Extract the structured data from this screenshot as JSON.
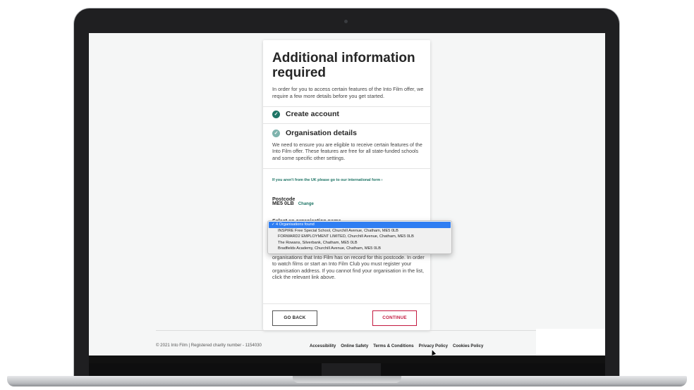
{
  "card": {
    "title": "Additional information required",
    "intro": "In order for you to access certain features of the Into Film offer, we require a few more details before you get started.",
    "steps": [
      {
        "label": "Create account",
        "icon": "check-circle-icon",
        "color": "#1f7566"
      },
      {
        "label": "Organisation details",
        "icon": "check-circle-icon",
        "color": "#7fb3ad"
      }
    ],
    "org_description": "We need to ensure you are eligible to receive certain features of the Into Film offer. These features are free for all state-funded schools and some specific other settings.",
    "international_link": "If you aren't from the UK please go to our international form ›",
    "postcode_label": "Postcode",
    "postcode_value": "ME5 0LB",
    "change_link": "Change",
    "select_label": "Select an organisation name",
    "org_help": "organisations that Into Film has on record for this postcode. In order to watch films or start an Into Film Club you must register your organisation address. If you cannot find your organisation in the list, click the relevant link above.",
    "go_back": "GO BACK",
    "continue": "CONTINUE"
  },
  "dropdown": {
    "options": [
      "4 Organisations found",
      "INSPIRE Free Special School, Churchill Avenue, Chatham, ME5 0LB",
      "FORWARD2 EMPLOYMENT LIMITED, Churchill Avenue, Chatham, ME5 0LB",
      "The Rowans, Silverbank, Chatham, ME5 0LB",
      "Bradfields Academy, Churchill Avenue, Chatham, ME5 0LB"
    ],
    "selected_mark": "✓"
  },
  "footer": {
    "copyright": "© 2021 Into Film | Registered charity number - 1154030",
    "links": [
      "Accessibility",
      "Online Safety",
      "Terms & Conditions",
      "Privacy Policy",
      "Cookies Policy"
    ]
  },
  "colors": {
    "accent_teal": "#1f7566",
    "continue_red": "#c3193f",
    "select_blue": "#2f7ef2"
  }
}
